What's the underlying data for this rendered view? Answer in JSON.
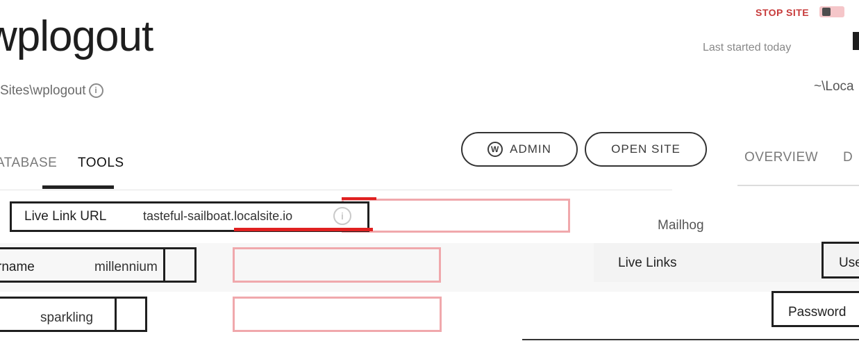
{
  "header": {
    "site_name": "wplogout",
    "site_path": "Sites\\wplogout",
    "stop_site_label": "STOP SITE",
    "last_started": "Last started today",
    "local_path": "~\\Loca"
  },
  "actions": {
    "admin_label": "ADMIN",
    "open_site_label": "OPEN SITE"
  },
  "tabs": {
    "database": "ATABASE",
    "tools": "TOOLS",
    "overview": "OVERVIEW",
    "database_right": "D"
  },
  "live_link": {
    "label": "Live Link URL",
    "url": "tasteful-sailboat.localsite.io"
  },
  "credentials": {
    "username_label": "rname",
    "username_value": "millennium",
    "password_value": "sparkling"
  },
  "side_list": {
    "mailhog": "Mailhog",
    "live_links": "Live Links",
    "user_label": "Use",
    "password_label": "Password"
  },
  "colors": {
    "stop_red": "#c73a3a",
    "highlight_red": "#e02020",
    "pink_outline": "#f0a8ac",
    "dark": "#1f1f1f"
  }
}
